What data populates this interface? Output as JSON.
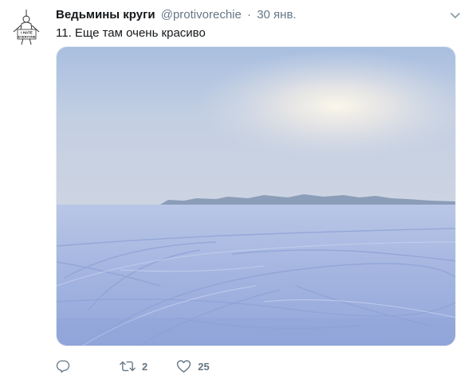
{
  "tweet": {
    "author": {
      "display_name": "Ведьмины круги",
      "handle": "@protivorechie",
      "avatar_text_line1": "I HATE",
      "avatar_text_line2": "EVERYONE"
    },
    "separator": "·",
    "time": "30 янв.",
    "text": "11. Еще там очень красиво",
    "media": {
      "description_icon": "photo"
    },
    "actions": {
      "reply_count": "",
      "retweet_count": "2",
      "like_count": "25"
    }
  },
  "colors": {
    "text_primary": "#14171a",
    "text_secondary": "#657786",
    "border": "#e6ecf0"
  },
  "icons": {
    "reply": "reply-icon",
    "retweet": "retweet-icon",
    "like": "heart-icon",
    "caret": "chevron-down-icon"
  }
}
